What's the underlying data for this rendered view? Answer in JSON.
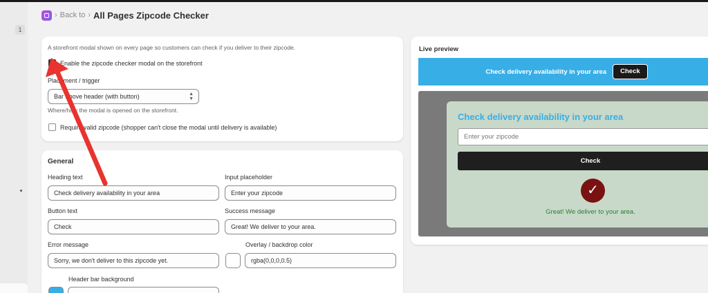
{
  "rail": {
    "page_number": "1"
  },
  "breadcrumb": {
    "back": "Back to",
    "title": "All Pages Zipcode Checker"
  },
  "settings": {
    "description": "A storefront modal shown on every page so customers can check if you deliver to their zipcode.",
    "enable_label": "Enable the zipcode checker modal on the storefront",
    "enable_checked": true,
    "placement_label": "Placement / trigger",
    "placement_value": "Bar above header (with button)",
    "placement_help": "Where/how the modal is opened on the storefront.",
    "require_label": "Require valid zipcode (shopper can't close the modal until delivery is available)",
    "require_checked": false
  },
  "general": {
    "title": "General",
    "heading_label": "Heading text",
    "heading_value": "Check delivery availability in your area",
    "placeholder_label": "Input placeholder",
    "placeholder_value": "Enter your zipcode",
    "button_label": "Button text",
    "button_value": "Check",
    "success_label": "Success message",
    "success_value": "Great! We deliver to your area.",
    "error_label": "Error message",
    "error_value": "Sorry, we don't deliver to this zipcode yet.",
    "overlay_label": "Overlay / backdrop color",
    "overlay_value": "rgba(0,0,0,0.5)",
    "header_bg_label": "Header bar background"
  },
  "preview": {
    "title": "Live preview",
    "bar_text": "Check delivery availability in your area",
    "bar_button": "Check",
    "modal_heading": "Check delivery availability in your area",
    "modal_placeholder": "Enter your zipcode",
    "modal_button": "Check",
    "success_message": "Great! We deliver to your area."
  },
  "colors": {
    "accent": "#37aee6",
    "success_icon": "#7a1212",
    "success_text": "#2e7d32",
    "annotation_arrow": "#e8332f"
  },
  "icons": [
    "app-icon",
    "checkmark-icon",
    "select-arrows-icon",
    "success-check-icon",
    "annotation-arrow"
  ]
}
